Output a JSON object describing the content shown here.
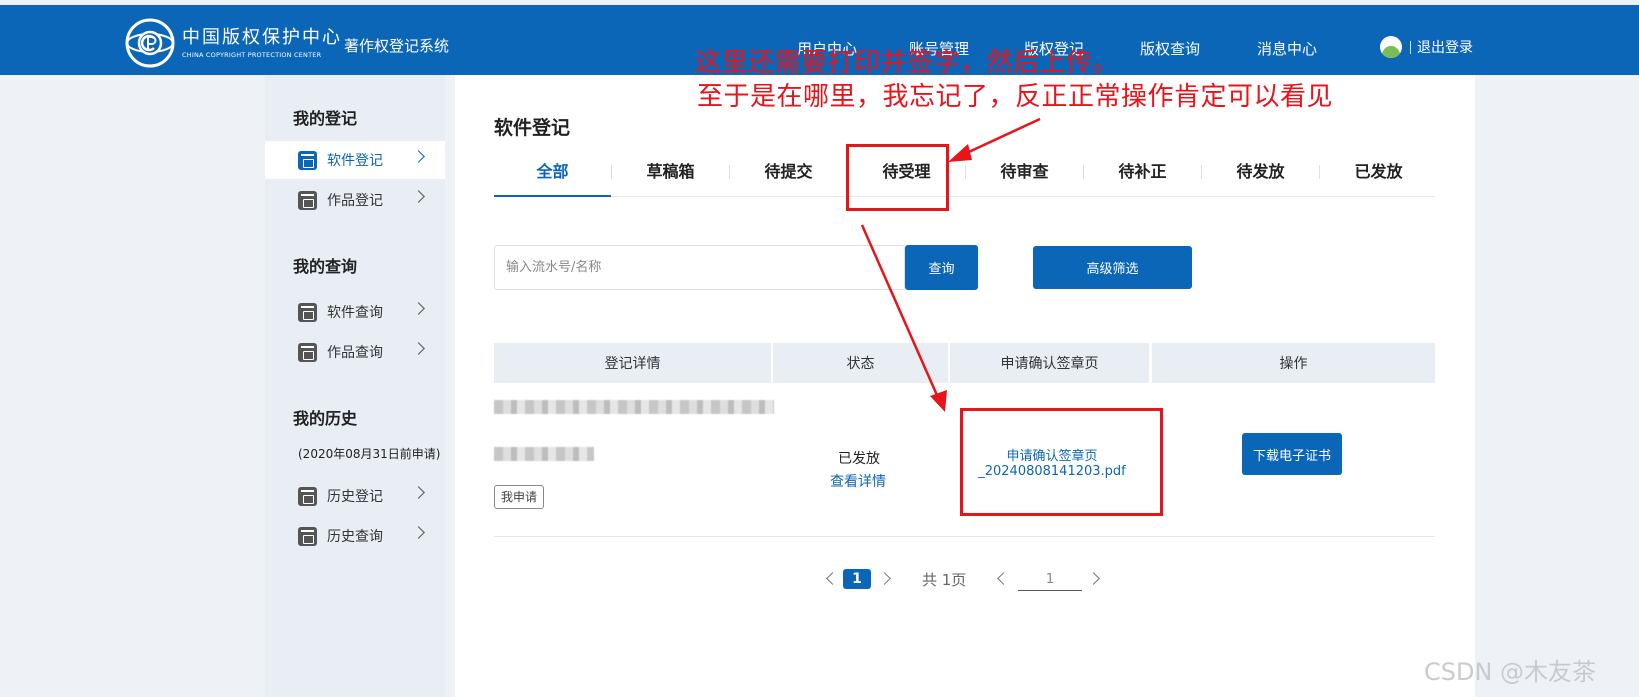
{
  "header": {
    "logo_cn": "中国版权保护中心",
    "logo_en": "CHINA COPYRIGHT PROTECTION CENTER",
    "system_title": "著作权登记系统",
    "nav": [
      "用户中心",
      "账号管理",
      "版权登记",
      "版权查询",
      "消息中心"
    ],
    "logout": "退出登录"
  },
  "sidebar": {
    "section_register": "我的登记",
    "item_software_register": "软件登记",
    "item_work_register": "作品登记",
    "section_query": "我的查询",
    "item_software_query": "软件查询",
    "item_work_query": "作品查询",
    "section_history": "我的历史",
    "history_note": "(2020年08月31日前申请)",
    "item_history_register": "历史登记",
    "item_history_query": "历史查询"
  },
  "main": {
    "page_title": "软件登记",
    "tabs": [
      "全部",
      "草稿箱",
      "待提交",
      "待受理",
      "待审查",
      "待补正",
      "待发放",
      "已发放"
    ],
    "search_placeholder": "输入流水号/名称",
    "search_button": "查询",
    "filter_button": "高级筛选",
    "table_headers": [
      "登记详情",
      "状态",
      "申请确认签章页",
      "操作"
    ],
    "row": {
      "tag": "我申请",
      "status": "已发放",
      "detail_link": "查看详情",
      "pdf_line1": "申请确认签章页",
      "pdf_line2": "_20240808141203.pdf",
      "download_button": "下载电子证书"
    },
    "pager": {
      "current": "1",
      "total": "共 1页",
      "goto": "1"
    }
  },
  "annotation": {
    "line1": "这里还需要打印并签字，然后上传。",
    "line2": "至于是在哪里，我忘记了，反正正常操作肯定可以看见",
    "color": "#e8141a"
  },
  "watermark": "CSDN @木友茶",
  "colors": {
    "primary": "#0b66b8",
    "sidebar_bg": "#e9eef5"
  }
}
